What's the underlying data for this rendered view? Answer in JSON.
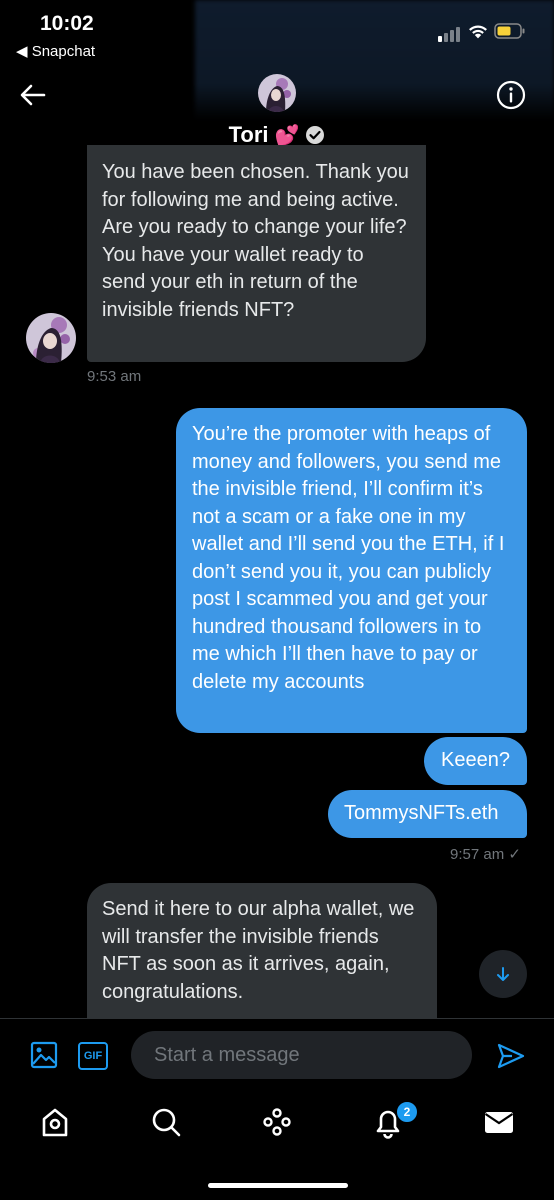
{
  "status_bar": {
    "time": "10:02",
    "back_app": "◀ Snapchat"
  },
  "header": {
    "name": "Tori",
    "emoji": "💕"
  },
  "messages": [
    {
      "dir": "in",
      "text": "You have been chosen. Thank you for following me and being active.\nAre you ready to change your life? You have your wallet ready to send your eth in return of the invisible friends NFT?",
      "time": "9:53 am"
    },
    {
      "dir": "out",
      "text": "You’re the promoter with heaps of money and followers, you send me the invisible friend, I’ll confirm it’s not a scam or a fake one in my wallet and I’ll send you the ETH, if I don’t send you it, you can publicly post I scammed you and get your hundred thousand followers in to me which I’ll then have to pay or delete my accounts"
    },
    {
      "dir": "out",
      "text": "Keeen?"
    },
    {
      "dir": "out",
      "text": "TommysNFTs.eth",
      "time": "9:57 am ✓"
    },
    {
      "dir": "in",
      "text": "Send it here to our alpha wallet, we will transfer the invisible friends NFT as soon as it arrives, again, congratulations."
    }
  ],
  "composer": {
    "placeholder": "Start a message",
    "gif_label": "GIF"
  },
  "tabbar": {
    "notification_count": "2"
  },
  "colors": {
    "accent": "#1d9bf0",
    "outgoing_bubble": "#3d97e6",
    "incoming_bubble": "#2f3336"
  },
  "icons": [
    "back-arrow-icon",
    "info-icon",
    "verified-icon",
    "image-icon",
    "gif-icon",
    "send-icon",
    "home-icon",
    "search-icon",
    "communities-icon",
    "bell-icon",
    "mail-icon",
    "chevron-down-icon"
  ]
}
